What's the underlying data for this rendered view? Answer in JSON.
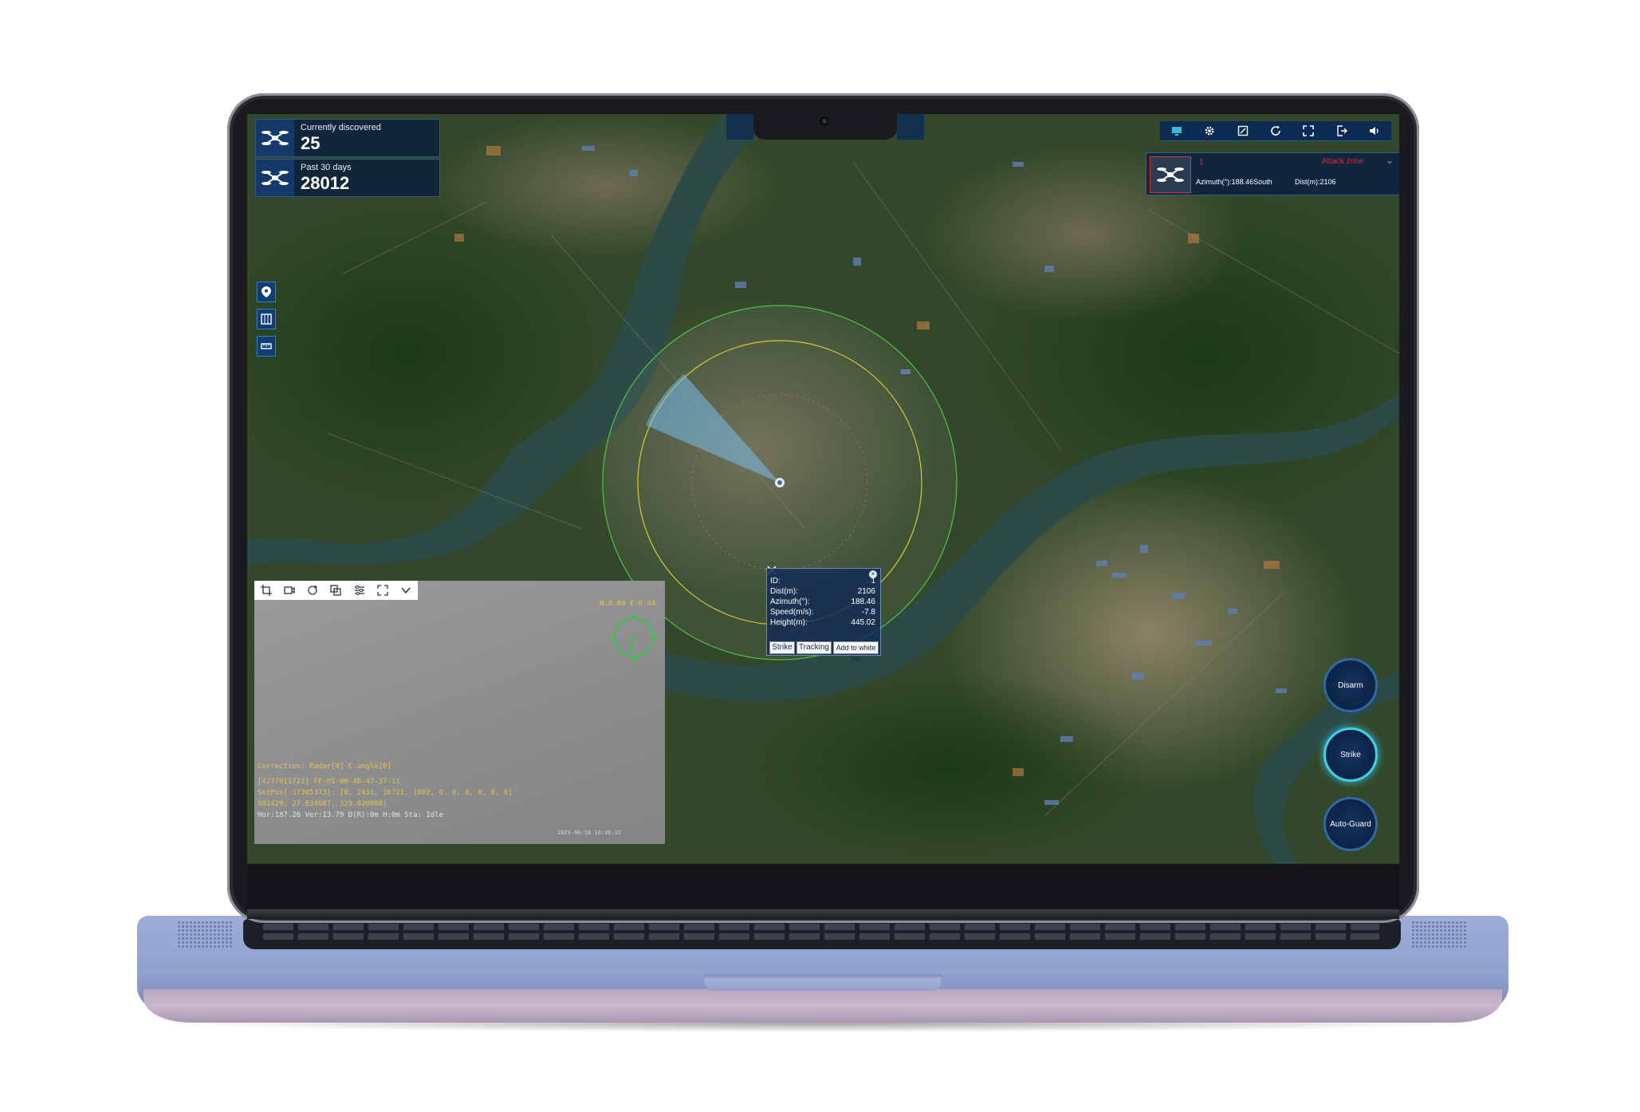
{
  "stats": {
    "discovered_label": "Currently discovered",
    "discovered_value": "25",
    "past_label": "Past 30 days",
    "past_value": "28012"
  },
  "target_card": {
    "id": "1",
    "zone": "Attack zone",
    "azimuth": "Azimuth(°):188.46South",
    "dist": "Dist(m):2106"
  },
  "popup": {
    "rows": [
      {
        "label": "ID:",
        "value": "1"
      },
      {
        "label": "Dist(m):",
        "value": "2106"
      },
      {
        "label": "Azimuth(°):",
        "value": "188.46"
      },
      {
        "label": "Speed(m/s):",
        "value": "-7.8"
      },
      {
        "label": "Height(m):",
        "value": "445.02"
      }
    ],
    "buttons": {
      "strike": "Strike",
      "tracking": "Tracking",
      "whitelist": "Add to white list"
    }
  },
  "video": {
    "osd_top": "N:0.00 E:0.44",
    "osd_lines": [
      "Correction: Radar[0] C.angle[0]",
      "[4277011721] FF-01-00-4B-47-37-11",
      "SetPos[-17305373]: [0, 2431, 16721, 1002, 0, 0, 0, 0, 0, 0]",
      " 981429, 27.834687, 329.020000]",
      "Hor:187.26 Ver:13.79 D(R):0m  H:0m  Sta: Idle"
    ],
    "osd_timestamp": "2023-06-18 10:36:32"
  },
  "actions": {
    "disarm": "Disarm",
    "strike": "Strike",
    "auto_guard": "Auto-Guard"
  },
  "colors": {
    "panel": "#0c2b52",
    "accent_red": "#e0263b",
    "osd_yellow": "#e7c24a",
    "range_green": "#4ec24a",
    "range_yellow": "#d9c83b",
    "laptop_base": "#95a5d2"
  }
}
